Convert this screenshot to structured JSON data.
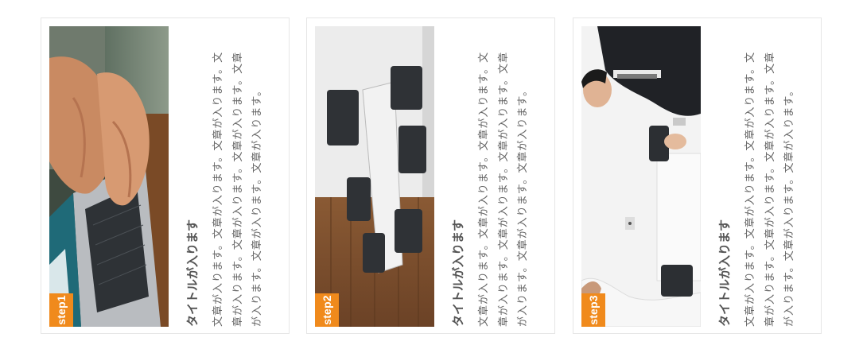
{
  "steps": [
    {
      "badge": "step1",
      "title": "タイトルが入ります",
      "text": "文章が入ります。文章が入ります。文章が入ります。文章が入ります。文章が入ります。文章が入ります。文章が入ります。文章が入ります。文章が入ります。",
      "photo": "laptop-typing-photo"
    },
    {
      "badge": "step2",
      "title": "タイトルが入ります",
      "text": "文章が入ります。文章が入ります。文章が入ります。文章が入ります。文章が入ります。文章が入ります。文章が入ります。文章が入ります。文章が入ります。",
      "photo": "meeting-room-photo"
    },
    {
      "badge": "step3",
      "title": "タイトルが入ります",
      "text": "文章が入ります。文章が入ります。文章が入ります。文章が入ります。文章が入ります。文章が入ります。文章が入ります。文章が入ります。文章が入ります。",
      "photo": "interview-photo"
    }
  ],
  "colors": {
    "badge": "#f08a1c",
    "text": "#555555",
    "border": "#e6e6e6"
  }
}
